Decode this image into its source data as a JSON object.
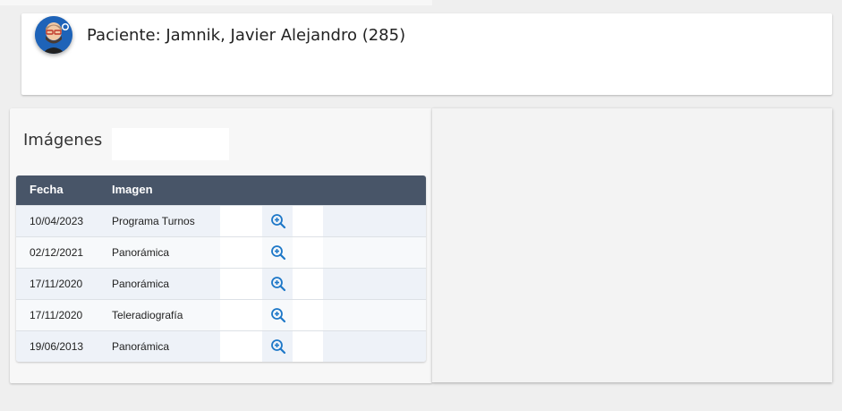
{
  "patient": {
    "title": "Paciente: Jamnik, Javier Alejandro (285)",
    "avatar_icon": "cartoon-avatar-icon"
  },
  "images_section": {
    "title": "Imágenes",
    "columns": [
      "Fecha",
      "Imagen"
    ],
    "rows": [
      {
        "date": "10/04/2023",
        "image": "Programa Turnos"
      },
      {
        "date": "02/12/2021",
        "image": "Panorámica"
      },
      {
        "date": "17/11/2020",
        "image": "Panorámica"
      },
      {
        "date": "17/11/2020",
        "image": "Teleradiografía"
      },
      {
        "date": "19/06/2013",
        "image": "Panorámica"
      }
    ],
    "row_action_icon": "zoom-in-icon"
  },
  "colors": {
    "header_bg": "#485568",
    "accent": "#1e78c8",
    "avatar_bg": "#1e63b8"
  }
}
